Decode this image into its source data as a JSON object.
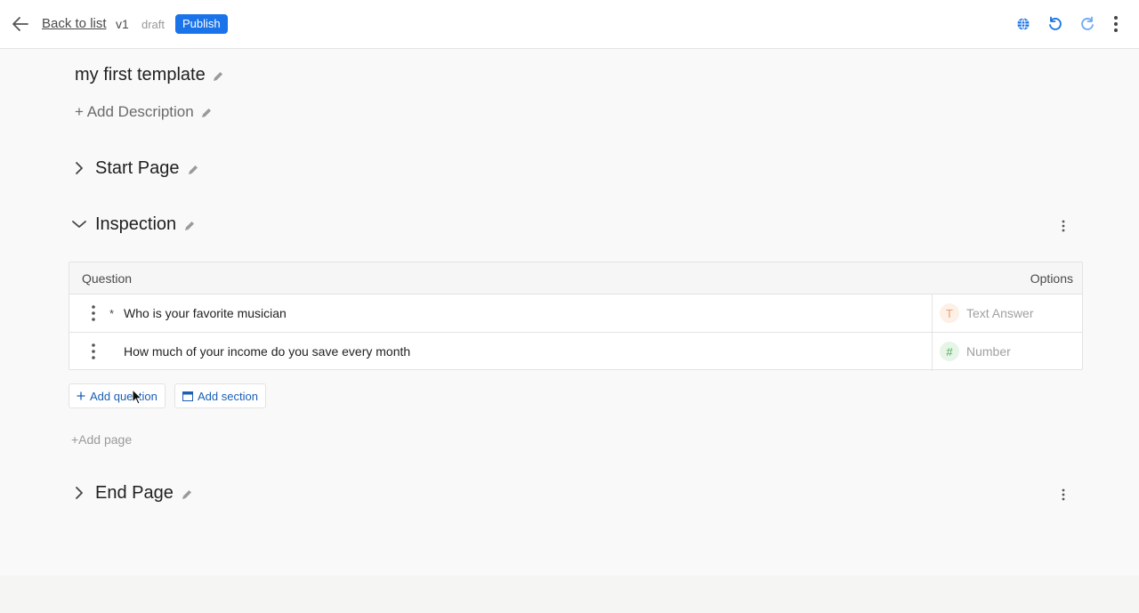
{
  "header": {
    "back_label": "Back to list",
    "version": "v1",
    "status": "draft",
    "publish_label": "Publish",
    "icons": [
      "arrow-left-icon",
      "globe-icon",
      "undo-icon",
      "redo-icon",
      "more-vertical-icon"
    ],
    "accent_color": "#1a73e8"
  },
  "template": {
    "title": "my first template",
    "add_description": "+ Add Description"
  },
  "sections": {
    "start": {
      "title": "Start Page",
      "expanded": false
    },
    "inspection": {
      "title": "Inspection",
      "expanded": true
    },
    "end": {
      "title": "End Page",
      "expanded": false
    }
  },
  "table": {
    "col_question": "Question",
    "col_options": "Options",
    "rows": [
      {
        "required_mark": "*",
        "question": "Who is your favorite musician",
        "type_glyph": "T",
        "type": "Text Answer",
        "type_color": "#f0a070"
      },
      {
        "required_mark": "",
        "question": "How much of your income do you save every month",
        "type_glyph": "#",
        "type": "Number",
        "type_color": "#4caf50"
      }
    ]
  },
  "actions": {
    "add_question": "Add question",
    "add_section": "Add section",
    "add_page": "+Add page"
  }
}
